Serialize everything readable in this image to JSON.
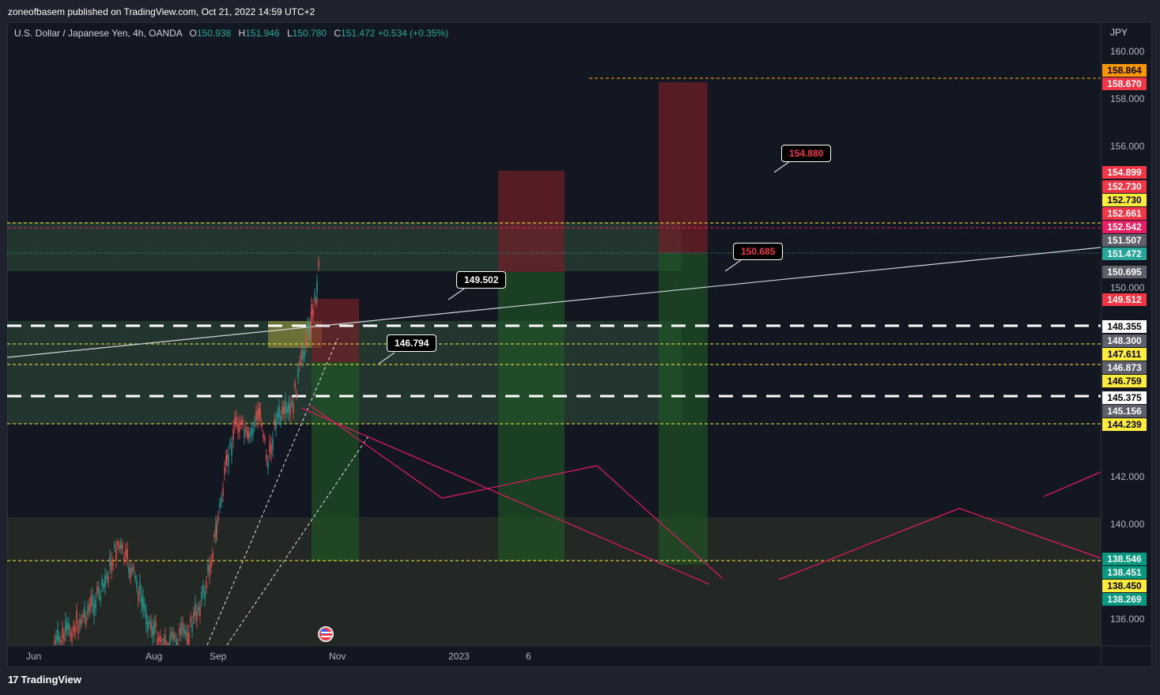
{
  "header": {
    "publisher_line": "zoneofbasem published on TradingView.com, Oct 21, 2022 14:59 UTC+2"
  },
  "symbol": {
    "description": "U.S. Dollar / Japanese Yen, 4h, OANDA",
    "open_label": "O",
    "open": "150.938",
    "high_label": "H",
    "high": "151.946",
    "low_label": "L",
    "low": "150.780",
    "close_label": "C",
    "close": "151.472",
    "change": "+0.534 (+0.35%)"
  },
  "price_axis": {
    "currency": "JPY",
    "ticks": [
      "160.000",
      "158.000",
      "156.000",
      "150.000",
      "142.000",
      "140.000",
      "136.000"
    ],
    "labels": [
      {
        "text": "158.864",
        "bg": "#ff9800",
        "fg": "#000000"
      },
      {
        "text": "158.670",
        "bg": "#f23645",
        "fg": "#ffffff"
      },
      {
        "text": "154.899",
        "bg": "#f23645",
        "fg": "#ffffff"
      },
      {
        "text": "152.730",
        "bg": "#f23645",
        "fg": "#ffffff"
      },
      {
        "text": "152.730",
        "bg": "#ffeb3b",
        "fg": "#000000"
      },
      {
        "text": "152.661",
        "bg": "#f23645",
        "fg": "#ffffff"
      },
      {
        "text": "152.542",
        "bg": "#e91e63",
        "fg": "#ffffff"
      },
      {
        "text": "151.507",
        "bg": "#5d606b",
        "fg": "#ffffff"
      },
      {
        "text": "151.472",
        "bg": "#26a69a",
        "fg": "#ffffff"
      },
      {
        "text": "150.695",
        "bg": "#5d606b",
        "fg": "#ffffff"
      },
      {
        "text": "149.512",
        "bg": "#f23645",
        "fg": "#ffffff"
      },
      {
        "text": "148.355",
        "bg": "#ffffff",
        "fg": "#000000"
      },
      {
        "text": "148.300",
        "bg": "#5d606b",
        "fg": "#ffffff"
      },
      {
        "text": "147.611",
        "bg": "#ffeb3b",
        "fg": "#000000"
      },
      {
        "text": "146.873",
        "bg": "#5d606b",
        "fg": "#ffffff"
      },
      {
        "text": "146.759",
        "bg": "#ffeb3b",
        "fg": "#000000"
      },
      {
        "text": "145.375",
        "bg": "#ffffff",
        "fg": "#000000"
      },
      {
        "text": "145.156",
        "bg": "#5d606b",
        "fg": "#ffffff"
      },
      {
        "text": "144.239",
        "bg": "#ffeb3b",
        "fg": "#000000"
      },
      {
        "text": "138.546",
        "bg": "#089981",
        "fg": "#ffffff"
      },
      {
        "text": "138.451",
        "bg": "#089981",
        "fg": "#ffffff"
      },
      {
        "text": "138.450",
        "bg": "#ffeb3b",
        "fg": "#000000"
      },
      {
        "text": "138.269",
        "bg": "#089981",
        "fg": "#ffffff"
      }
    ]
  },
  "time_axis": {
    "ticks": [
      "Jun",
      "Aug",
      "Sep",
      "Nov",
      "2023",
      "6"
    ]
  },
  "callouts": [
    {
      "text": "154.880",
      "color": "#f23645"
    },
    {
      "text": "150.685",
      "color": "#f23645"
    },
    {
      "text": "149.502",
      "color": "#ffffff"
    },
    {
      "text": "146.794",
      "color": "#ffffff"
    }
  ],
  "footer": {
    "logo_mark": "17",
    "brand": "TradingView"
  },
  "colors": {
    "background": "#131722",
    "up_candle": "#26a69a",
    "down_candle": "#ef5350",
    "projection": "#d81b60",
    "level_line": "#ffeb3b"
  }
}
